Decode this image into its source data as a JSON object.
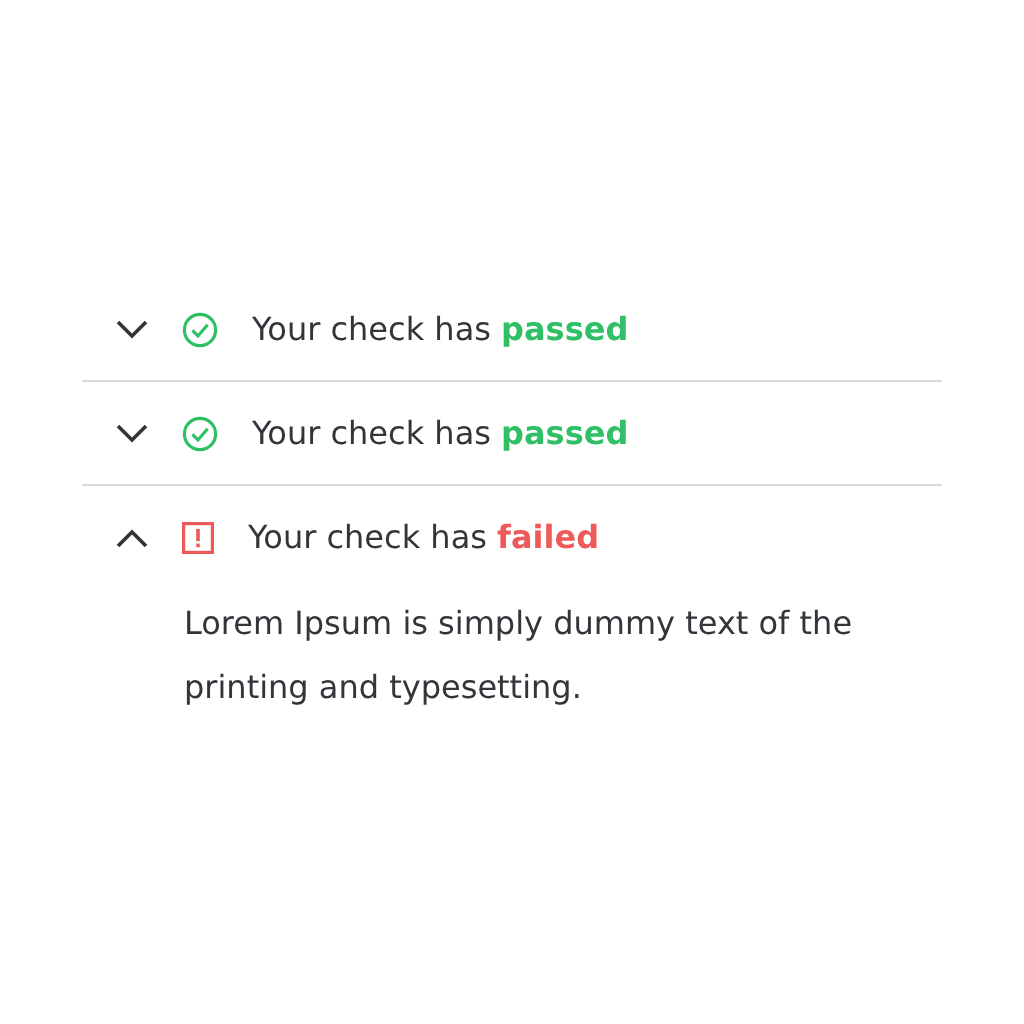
{
  "checks": [
    {
      "title": "Your check has **passed**",
      "kind": "passed",
      "expanded": false
    },
    {
      "title": "Your check has **passed**",
      "kind": "passed",
      "expanded": false
    },
    {
      "title": "Your check has **failed**",
      "kind": "failed",
      "expanded": true,
      "body": "Lorem Ipsum is simply dummy text of the printing and typesetting."
    }
  ]
}
